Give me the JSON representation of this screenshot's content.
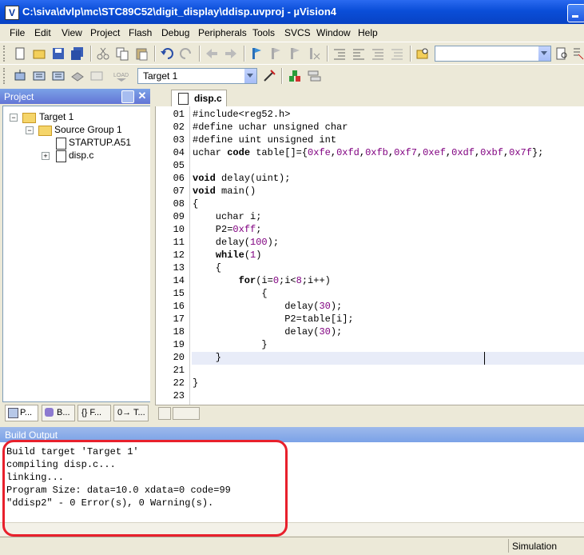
{
  "window": {
    "title": "C:\\siva\\dvlp\\mc\\STC89C52\\digit_display\\ddisp.uvproj - µVision4",
    "app_icon": "V"
  },
  "menu": [
    "File",
    "Edit",
    "View",
    "Project",
    "Flash",
    "Debug",
    "Peripherals",
    "Tools",
    "SVCS",
    "Window",
    "Help"
  ],
  "toolbar2": {
    "target": "Target 1"
  },
  "project": {
    "title": "Project",
    "tree": {
      "target": "Target 1",
      "group": "Source Group 1",
      "files": [
        "STARTUP.A51",
        "disp.c"
      ]
    },
    "tabs": [
      "P...",
      "B...",
      "{} F...",
      "0→ T..."
    ]
  },
  "editor": {
    "tab": "disp.c",
    "line_numbers": [
      "01",
      "02",
      "03",
      "04",
      "05",
      "06",
      "07",
      "08",
      "09",
      "10",
      "11",
      "12",
      "13",
      "14",
      "15",
      "16",
      "17",
      "18",
      "19",
      "20",
      "21",
      "22",
      "23"
    ],
    "current_line": "20"
  },
  "build_output": {
    "title": "Build Output",
    "lines": [
      "Build target 'Target 1'",
      "compiling disp.c...",
      "linking...",
      "Program Size: data=10.0 xdata=0 code=99",
      "\"ddisp2\" - 0 Error(s), 0 Warning(s)."
    ]
  },
  "status": {
    "mode": "Simulation"
  },
  "colors": {
    "title_bar": "#0a4ed8",
    "highlight": "#e8202c",
    "number_literal": "#800080"
  }
}
